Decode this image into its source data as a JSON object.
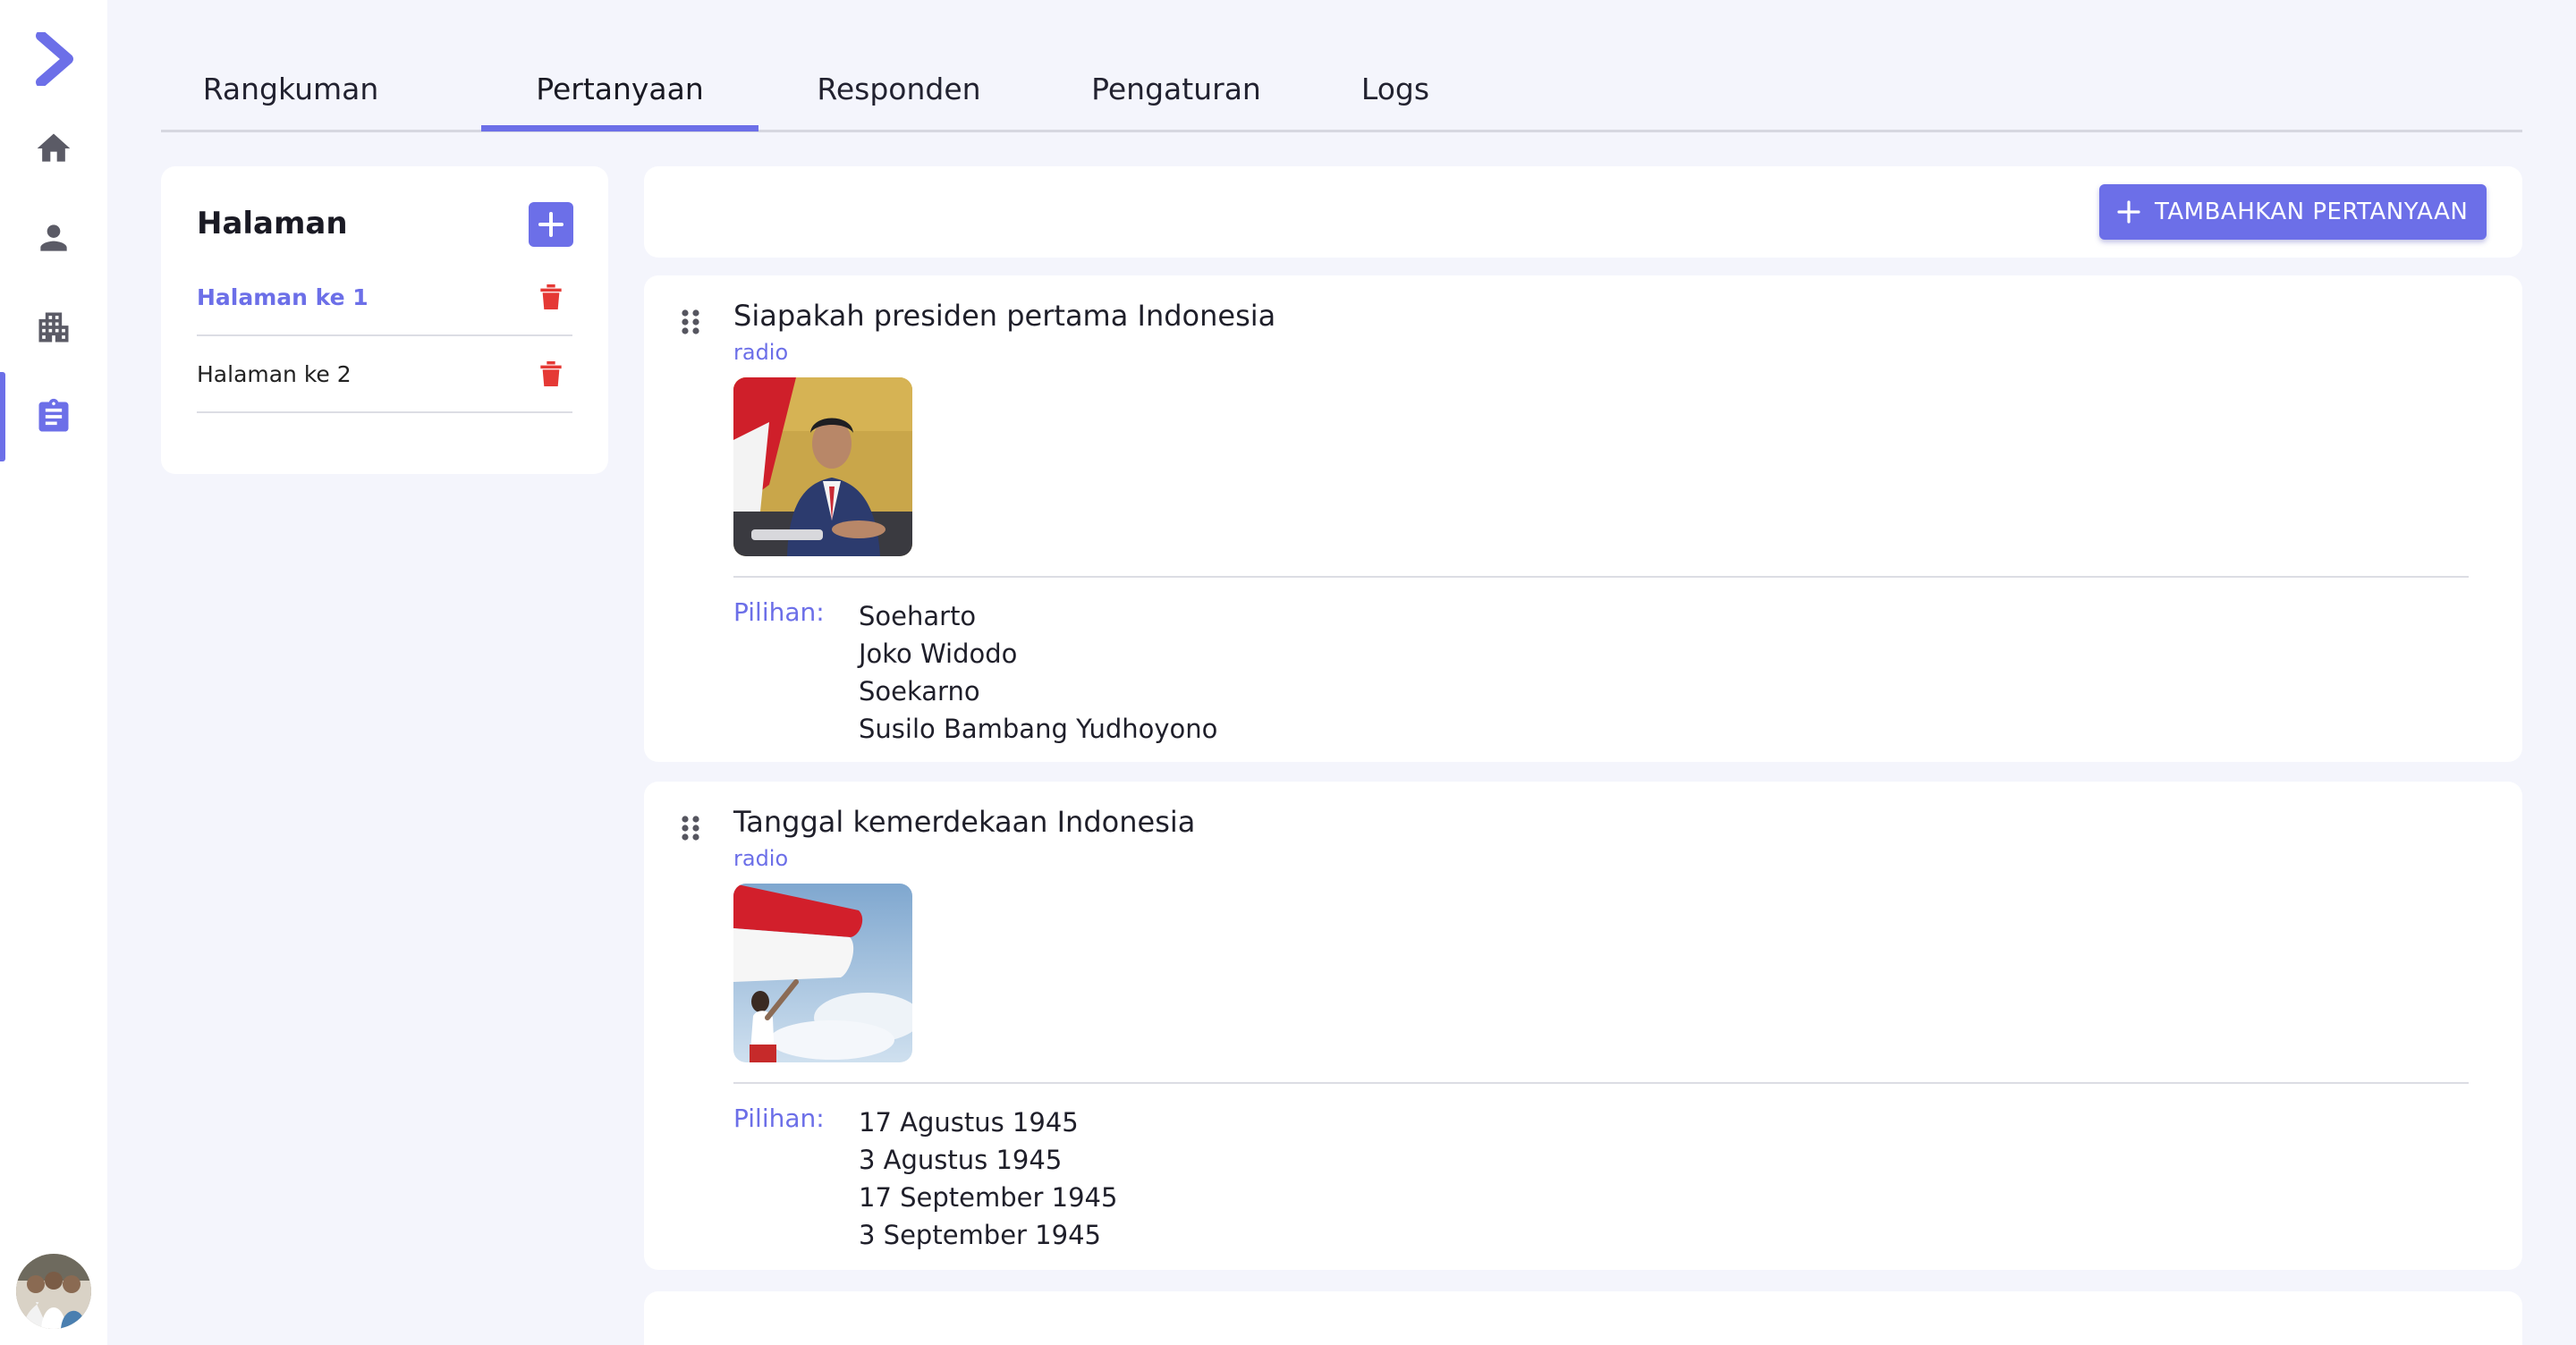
{
  "sidebar": {
    "items": [
      {
        "icon": "chevron-right-icon",
        "active": false
      },
      {
        "icon": "home-icon",
        "active": false
      },
      {
        "icon": "person-icon",
        "active": false
      },
      {
        "icon": "buildings-icon",
        "active": false
      },
      {
        "icon": "clipboard-icon",
        "active": true
      }
    ]
  },
  "tabs": [
    {
      "label": "Rangkuman"
    },
    {
      "label": "Pertanyaan"
    },
    {
      "label": "Responden"
    },
    {
      "label": "Pengaturan"
    },
    {
      "label": "Logs"
    }
  ],
  "active_tab": "Pertanyaan",
  "pages": {
    "title": "Halaman",
    "items": [
      {
        "label": "Halaman ke 1",
        "active": true
      },
      {
        "label": "Halaman ke 2",
        "active": false
      }
    ]
  },
  "toolbar": {
    "add_question_label": "TAMBAHKAN PERTANYAAN"
  },
  "questions": [
    {
      "title": "Siapakah presiden pertama Indonesia",
      "type": "radio",
      "options_label": "Pilihan:",
      "options": [
        "Soeharto",
        "Joko Widodo",
        "Soekarno",
        "Susilo Bambang Yudhoyono"
      ]
    },
    {
      "title": "Tanggal kemerdekaan Indonesia",
      "type": "radio",
      "options_label": "Pilihan:",
      "options": [
        "17 Agustus 1945",
        "3 Agustus 1945",
        "17 September 1945",
        "3 September 1945"
      ]
    }
  ],
  "colors": {
    "accent": "#6c6fe8",
    "danger": "#e53935",
    "background": "#f4f5fc"
  }
}
